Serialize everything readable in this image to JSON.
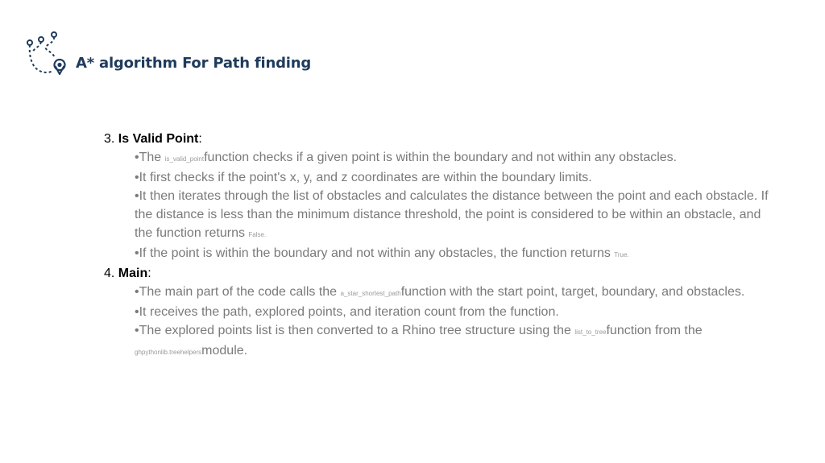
{
  "header": {
    "title": "A* algorithm For Path finding",
    "logo_icon": "route-map-pin-icon",
    "title_color": "#1f3b5c"
  },
  "sections": [
    {
      "number": "3.",
      "title": "Is Valid Point",
      "suffix": ":",
      "bullets": [
        {
          "pre": "•The ",
          "code": "is_valid_point",
          "post": "function checks if a given point is within the boundary and not within any obstacles."
        },
        {
          "pre": "•It first checks if the point's x, y, and z coordinates are within the boundary limits.",
          "code": "",
          "post": ""
        },
        {
          "pre": "•It then iterates through the list of obstacles and calculates the distance between the point and each obstacle. If the distance is less than the minimum distance threshold, the point is considered to be within an obstacle, and the function returns ",
          "code": "False.",
          "post": ""
        },
        {
          "pre": "•If the point is within the boundary and not within any obstacles, the function returns ",
          "code": "True.",
          "post": ""
        }
      ]
    },
    {
      "number": "4.",
      "title": "Main",
      "suffix": ":",
      "bullets": [
        {
          "pre": "•The main part of the code calls the ",
          "code": "a_star_shortest_path",
          "post": "function with the start point, target, boundary, and obstacles."
        },
        {
          "pre": "•It receives the path, explored points, and iteration count from the function.",
          "code": "",
          "post": ""
        },
        {
          "pre": "•The explored points list is then converted to a Rhino tree structure using the ",
          "code": "list_to_tree",
          "post": "function from the ",
          "code2": "ghpythonlib.treehelpers",
          "post2": "module."
        }
      ]
    }
  ]
}
